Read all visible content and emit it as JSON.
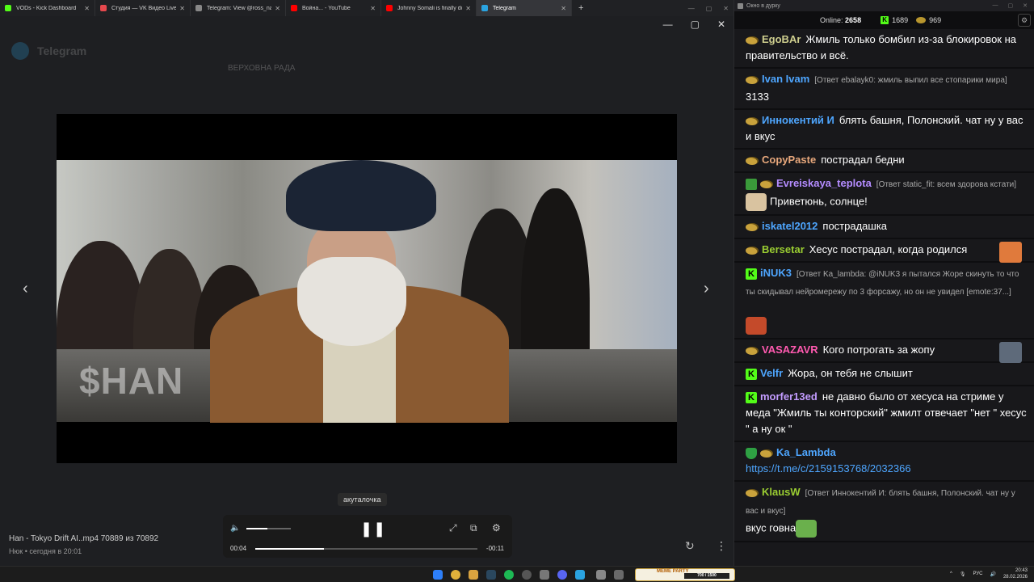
{
  "browser": {
    "tabs": [
      {
        "label": "VODs - Kick Dashboard",
        "color": "#53fc18"
      },
      {
        "label": "Студия — VK Видео Live",
        "color": "#e5484d"
      },
      {
        "label": "Telegram: View @ross_name",
        "color": "#888888"
      },
      {
        "label": "Война... - YouTube",
        "color": "#ff0000"
      },
      {
        "label": "Johnny Somali is finally done..",
        "color": "#ff0000"
      },
      {
        "label": "Telegram",
        "color": "#2aa3e0"
      }
    ],
    "new_tab": "+",
    "window_controls": [
      "—",
      "▢",
      "✕"
    ]
  },
  "telegram": {
    "title": "Telegram",
    "ghost_header": "ВЕРХОВНА РАДА"
  },
  "viewer": {
    "watermark": "$HAN",
    "tooltip": "акуталочка",
    "controls": {
      "current_time": "00:04",
      "remaining_time": "-00:11",
      "progress": 0.31,
      "volume": 0.47
    },
    "file_name": "Han - Tokyo Drift AI..mp4 70889 из 70892",
    "file_meta": "Нюк • сегодня в 20:01",
    "nav_prev": "‹",
    "nav_next": "›"
  },
  "chat": {
    "window_title": "Окно в дурку",
    "online_label": "Online:",
    "online_count": "2658",
    "kick_count": "1689",
    "coin_count": "969",
    "messages": [
      {
        "badges": [
          "coin"
        ],
        "nick": "EgoBAr",
        "color": "#cfcf8f",
        "reply": "",
        "text": "Жмиль только бомбил из-за блокировок на правительство и всё."
      },
      {
        "badges": [
          "coin"
        ],
        "nick": "Ivan Ivam",
        "color": "#4ea6ff",
        "reply": "[Ответ ebalayk0: жмиль выпил все стопарики мира]",
        "text": "3133"
      },
      {
        "badges": [
          "coin"
        ],
        "nick": "Иннокентий И",
        "color": "#4ea6ff",
        "reply": "",
        "text": "блять башня, Полонский. чат ну у вас и вкус"
      },
      {
        "badges": [
          "coin"
        ],
        "nick": "CopyPaste",
        "color": "#e8a87c",
        "reply": "",
        "text": "пострадал бедни"
      },
      {
        "badges": [
          "mod",
          "coin"
        ],
        "nick": "Evreiskaya_teplota",
        "color": "#b48cff",
        "reply": "[Ответ static_fit: всем здорова кстати]",
        "text": "Приветюнь, солнце!"
      },
      {
        "badges": [
          "coin"
        ],
        "nick": "iskatel2012",
        "color": "#4ea6ff",
        "reply": "",
        "text": "пострадашка"
      },
      {
        "badges": [
          "coin"
        ],
        "nick": "Bersetar",
        "color": "#9acd32",
        "reply": "",
        "text": "Хесус пострадал, когда родился"
      },
      {
        "badges": [
          "kick"
        ],
        "nick": "iNUK3",
        "color": "#4ea6ff",
        "reply": "[Ответ Ka_lambda: @iNUK3 я пытался Жоре скинуть то что ты скидывал нейромережу по 3 форсажу, но он не увидел [emote:37...]",
        "text": ""
      },
      {
        "badges": [
          "coin"
        ],
        "nick": "VASAZAVR",
        "color": "#ff5ab0",
        "reply": "",
        "text": "Кого потрогать за жопу"
      },
      {
        "badges": [
          "kick"
        ],
        "nick": "Velfr",
        "color": "#4ea6ff",
        "reply": "",
        "text": "Жора, он тебя не слышит"
      },
      {
        "badges": [
          "kick"
        ],
        "nick": "morfer13ed",
        "color": "#c39cff",
        "reply": "",
        "text": "не давно было от хесуса на стриме у меда \"Жмиль ты конторский\" жмилт отвечает \"нет \" хесус \" а ну ок \""
      },
      {
        "badges": [
          "shield",
          "coin"
        ],
        "nick": "Ka_Lambda",
        "color": "#4ea6ff",
        "reply": "",
        "link": "https://t.me/c/2159153768/2032366",
        "text": ""
      },
      {
        "badges": [
          "coin"
        ],
        "nick": "KlausW",
        "color": "#9acd32",
        "reply": "[Ответ Иннокентий И: блять башня, Полонский. чат ну у вас и вкус]",
        "text": "вкус говна"
      }
    ]
  },
  "taskbar": {
    "meme_label": "MEME PARTY",
    "meme_progress": "700 / 1500",
    "lang": "РУС",
    "time": "20:43",
    "date": "28.02.2026"
  }
}
